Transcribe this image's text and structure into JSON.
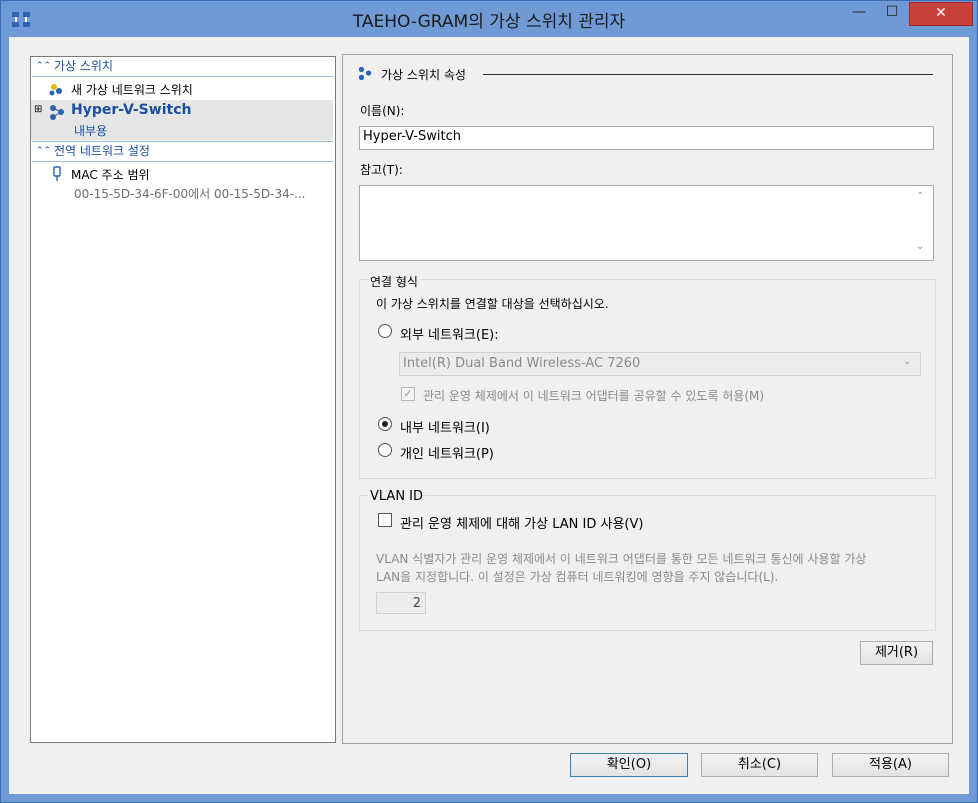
{
  "window": {
    "title": "TAEHO-GRAM의 가상 스위치 관리자"
  },
  "titlebar": {
    "minimize": "—",
    "maximize": "☐",
    "close": "✕"
  },
  "left": {
    "virtual_switches_header": "가상 스위치",
    "new_switch_label": "새 가상 네트워크 스위치",
    "switch_name": "Hyper-V-Switch",
    "switch_type": "내부용",
    "global_header": "전역 네트워크 설정",
    "mac_label": "MAC 주소 범위",
    "mac_value": "00-15-5D-34-6F-00에서 00-15-5D-34-..."
  },
  "props": {
    "section_title": "가상 스위치 속성",
    "name_label": "이름(N):",
    "name_value": "Hyper-V-Switch",
    "notes_label": "참고(T):",
    "notes_value": "",
    "conn_group": "연결 형식",
    "conn_desc": "이 가상 스위치를 연결할 대상을 선택하십시오.",
    "external_label": "외부 네트워크(E):",
    "adapter_value": "Intel(R) Dual Band Wireless-AC 7260",
    "share_label": "관리 운영 체제에서 이 네트워크 어댑터를 공유할 수 있도록 허용(M)",
    "internal_label": "내부 네트워크(I)",
    "private_label": "개인 네트워크(P)",
    "vlan_group": "VLAN ID",
    "vlan_check_label": "관리 운영 체제에 대해 가상 LAN ID 사용(V)",
    "vlan_desc_line1": "VLAN 식별자가 관리 운영 체제에서 이 네트워크 어댑터를 통한 모든 네트워크 통신에 사용할 가상",
    "vlan_desc_line2": "LAN을 지정합니다. 이 설정은 가상 컴퓨터 네트워킹에 영향을 주지 않습니다(L).",
    "vlan_value": "2",
    "remove_button": "제거(R)"
  },
  "footer": {
    "ok": "확인(O)",
    "cancel": "취소(C)",
    "apply": "적용(A)"
  },
  "icons": {
    "app": "network-switch-icon",
    "switch": "network-switch-icon",
    "new": "new-switch-icon",
    "mac": "mac-address-icon"
  }
}
